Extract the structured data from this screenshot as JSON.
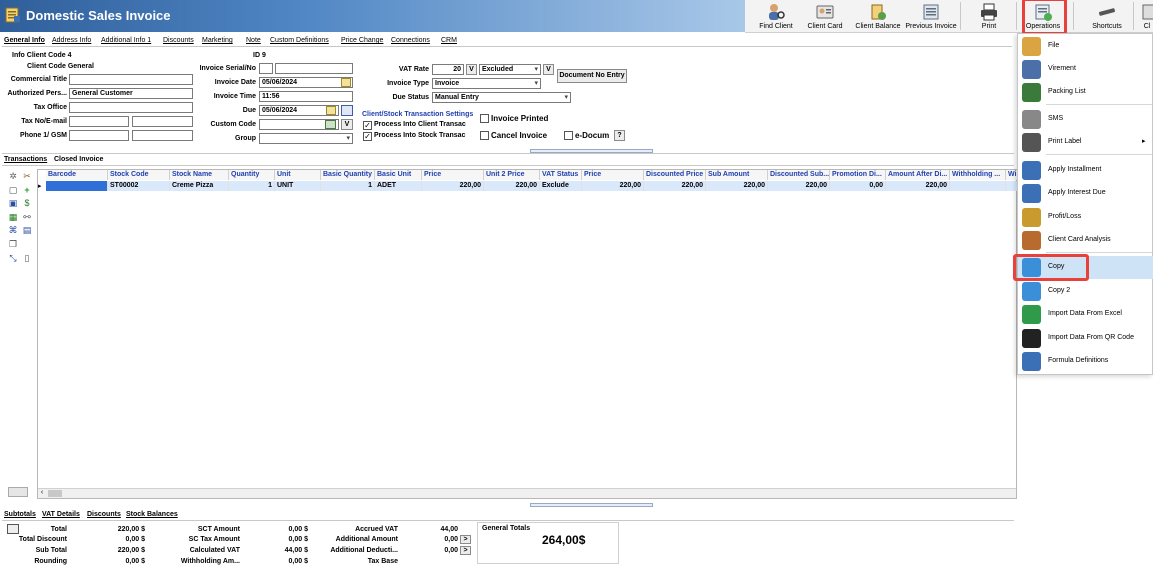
{
  "window": {
    "title": "Domestic Sales Invoice"
  },
  "toolbar": {
    "find_client": "Find Client",
    "client_card": "Client Card",
    "client_balance": "Client Balance",
    "previous_invoice": "Previous Invoice",
    "print": "Print",
    "operations": "Operations",
    "shortcuts": "Shortcuts",
    "close": "Cl"
  },
  "tabs": {
    "general_info": "General Info",
    "address_info": "Address Info",
    "additional_info_1": "Additional Info 1",
    "discounts": "Discounts",
    "marketing": "Marketing",
    "note": "Note",
    "custom_definitions": "Custom Definitions",
    "price_change": "Price Change",
    "connections": "Connections",
    "crm": "CRM"
  },
  "form": {
    "info_client_code": "Info Client Code 4",
    "id": "ID 9",
    "client_code": "Client Code General",
    "commercial_title_label": "Commercial Title",
    "authorized_person_label": "Authorized Pers...",
    "authorized_person_value": "General Customer",
    "tax_office_label": "Tax Office",
    "tax_no_label": "Tax No/E-mail",
    "phone_label": "Phone 1/ GSM",
    "invoice_serial_label": "Invoice Serial/No",
    "invoice_date_label": "Invoice Date",
    "invoice_date_value": "05/06/2024",
    "invoice_time_label": "Invoice Time",
    "invoice_time_value": "11:56",
    "due_label": "Due",
    "due_value": "05/06/2024",
    "custom_code_label": "Custom Code",
    "group_label": "Group",
    "vat_rate_label": "VAT Rate",
    "vat_rate_value": "20",
    "v_label": "V",
    "vat_mode_value": "Excluded",
    "document_no_entry": "Document No Entry",
    "invoice_type_label": "Invoice Type",
    "invoice_type_value": "Invoice",
    "due_status_label": "Due Status",
    "due_status_value": "Manual Entry",
    "transaction_settings_label": "Client/Stock Transaction Settings",
    "process_client_label": "Process Into Client Transac",
    "process_stock_label": "Process Into Stock Transac",
    "invoice_printed_label": "Invoice Printed",
    "cancel_invoice_label": "Cancel Invoice",
    "e_document_label": "e-Docum",
    "question_label": "?"
  },
  "transactions": {
    "tab_transactions": "Transactions",
    "tab_closed_invoice": "Closed Invoice",
    "columns": [
      "Barcode",
      "Stock Code",
      "Stock Name",
      "Quantity",
      "Unit",
      "Basic Quantity",
      "Basic Unit",
      "Price",
      "Unit 2 Price",
      "VAT Status",
      "Price",
      "Discounted Price",
      "Sub Amount",
      "Discounted Sub...",
      "Promotion Di...",
      "Amount After Di...",
      "Withholding ...",
      "Wi"
    ],
    "rows": [
      [
        "",
        "ST00002",
        "Creme Pizza",
        "1",
        "UNIT",
        "1",
        "ADET",
        "220,00",
        "220,00",
        "Exclude",
        "220,00",
        "220,00",
        "220,00",
        "220,00",
        "0,00",
        "220,00",
        "",
        ""
      ]
    ]
  },
  "bottom_tabs": {
    "subtotals": "Subtotals",
    "vat_details": "VAT Details",
    "discounts": "Discounts",
    "stock_balances": "Stock Balances"
  },
  "totals": {
    "total_label": "Total",
    "total_value": "220,00 $",
    "total_discount_label": "Total Discount",
    "total_discount_value": "0,00 $",
    "sub_total_label": "Sub Total",
    "sub_total_value": "220,00 $",
    "rounding_label": "Rounding",
    "rounding_value": "0,00 $",
    "sct_amount_label": "SCT Amount",
    "sct_amount_value": "0,00 $",
    "sc_tax_amount_label": "SC Tax Amount",
    "sc_tax_amount_value": "0,00 $",
    "calculated_vat_label": "Calculated VAT",
    "calculated_vat_value": "44,00 $",
    "withholding_label": "Withholding Am...",
    "withholding_value": "0,00 $",
    "accrued_vat_label": "Accrued VAT",
    "accrued_vat_value": "44,00",
    "additional_amount_label": "Additional Amount",
    "additional_amount_value": "0,00",
    "additional_deduction_label": "Additional Deducti...",
    "additional_deduction_value": "0,00",
    "tax_base_label": "Tax Base",
    "more_button": ">",
    "general_totals_label": "General Totals",
    "general_totals_value": "264,00$"
  },
  "menu": {
    "items": [
      "File",
      "Virement",
      "Packing List",
      "SMS",
      "Print Label",
      "Apply Installment",
      "Apply Interest Due",
      "Profit/Loss",
      "Client Card Analysis",
      "Copy",
      "Copy 2",
      "Import Data From Excel",
      "Import Data From QR Code",
      "Formula Definitions"
    ],
    "submenu_arrow": "▸"
  },
  "colors": {
    "title_blue": "#2f5f9b",
    "highlight_red": "#e8413b",
    "menu_selected": "#cfe3f7",
    "header_blue": "#1f3fae"
  }
}
